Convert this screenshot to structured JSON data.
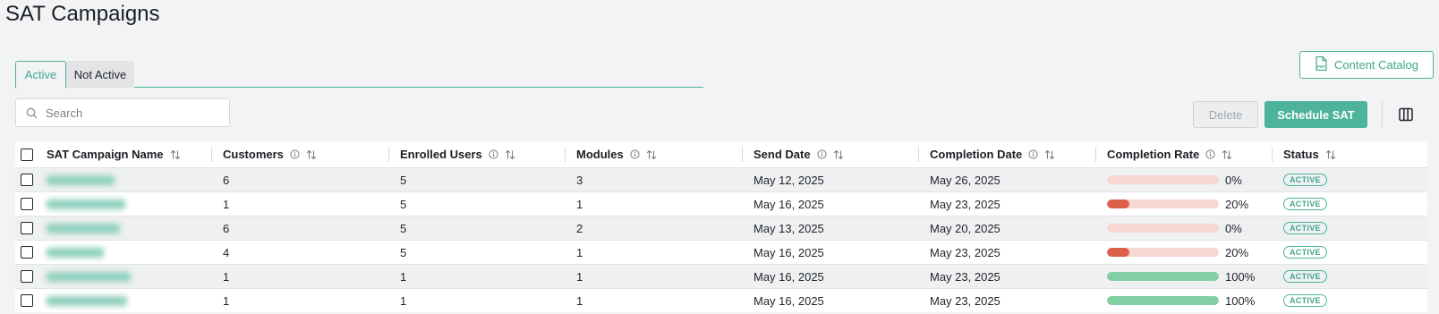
{
  "page": {
    "title": "SAT Campaigns"
  },
  "tabs": [
    {
      "label": "Active",
      "active": true
    },
    {
      "label": "Not Active",
      "active": false
    }
  ],
  "toolbar": {
    "content_catalog_label": "Content Catalog",
    "search_placeholder": "Search",
    "delete_label": "Delete",
    "schedule_label": "Schedule SAT"
  },
  "table": {
    "columns": [
      {
        "label": "SAT Campaign Name",
        "info": false
      },
      {
        "label": "Customers",
        "info": true
      },
      {
        "label": "Enrolled Users",
        "info": true
      },
      {
        "label": "Modules",
        "info": true
      },
      {
        "label": "Send Date",
        "info": true
      },
      {
        "label": "Completion Date",
        "info": true
      },
      {
        "label": "Completion Rate",
        "info": true
      },
      {
        "label": "Status",
        "info": false
      }
    ],
    "rows": [
      {
        "name": "",
        "customers": "6",
        "enrolled": "5",
        "modules": "3",
        "send_date": "May 12, 2025",
        "completion_date": "May 26, 2025",
        "rate_label": "0%",
        "rate": 0,
        "status": "ACTIVE"
      },
      {
        "name": "",
        "customers": "1",
        "enrolled": "5",
        "modules": "1",
        "send_date": "May 16, 2025",
        "completion_date": "May 23, 2025",
        "rate_label": "20%",
        "rate": 20,
        "status": "ACTIVE"
      },
      {
        "name": "",
        "customers": "6",
        "enrolled": "5",
        "modules": "2",
        "send_date": "May 13, 2025",
        "completion_date": "May 20, 2025",
        "rate_label": "0%",
        "rate": 0,
        "status": "ACTIVE"
      },
      {
        "name": "",
        "customers": "4",
        "enrolled": "5",
        "modules": "1",
        "send_date": "May 16, 2025",
        "completion_date": "May 23, 2025",
        "rate_label": "20%",
        "rate": 20,
        "status": "ACTIVE"
      },
      {
        "name": "",
        "customers": "1",
        "enrolled": "1",
        "modules": "1",
        "send_date": "May 16, 2025",
        "completion_date": "May 23, 2025",
        "rate_label": "100%",
        "rate": 100,
        "status": "ACTIVE"
      },
      {
        "name": "",
        "customers": "1",
        "enrolled": "1",
        "modules": "1",
        "send_date": "May 16, 2025",
        "completion_date": "May 23, 2025",
        "rate_label": "100%",
        "rate": 100,
        "status": "ACTIVE"
      }
    ]
  },
  "colors": {
    "accent": "#4db39a",
    "low_rate_fill": "#dc6049",
    "full_rate_fill": "#84cea4",
    "rate_track": "#f6d7d2"
  }
}
